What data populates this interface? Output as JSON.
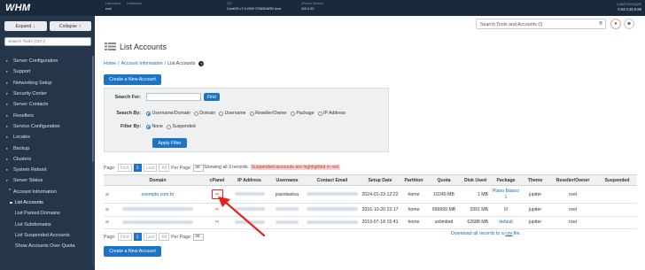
{
  "topbar": {
    "logo": "WHM",
    "username_label": "Username",
    "username": "root",
    "hostname_label": "Hostname",
    "hostname": "",
    "os_label": "OS",
    "os": "CentOS v7.9.2009 STANDARD kvm",
    "version_label": "cPanel Version",
    "version": "110.0.20",
    "load_label": "Load Averages",
    "load": "0.04 0.36 0.65"
  },
  "sidebar": {
    "expand_label": "Expand",
    "collapse_label": "Collapse",
    "search_placeholder": "Search Tools (Ctrl /)",
    "items": [
      {
        "label": "Server Configuration"
      },
      {
        "label": "Support"
      },
      {
        "label": "Networking Setup"
      },
      {
        "label": "Security Center"
      },
      {
        "label": "Server Contacts"
      },
      {
        "label": "Resellers"
      },
      {
        "label": "Service Configuration"
      },
      {
        "label": "Locales"
      },
      {
        "label": "Backup"
      },
      {
        "label": "Clusters"
      },
      {
        "label": "System Reboot"
      },
      {
        "label": "Server Status"
      },
      {
        "label": "Account Information"
      }
    ],
    "subitems": [
      {
        "label": "List Accounts"
      },
      {
        "label": "List Parked Domains"
      },
      {
        "label": "List Subdomains"
      },
      {
        "label": "List Suspended Accounts"
      },
      {
        "label": "Show Accounts Over Quota"
      }
    ]
  },
  "header": {
    "search_placeholder": "Search Tools and Accounts (/)"
  },
  "page": {
    "title": "List Accounts",
    "breadcrumb": [
      "Home",
      "Account Information",
      "List Accounts"
    ],
    "create_button": "Create a New Account"
  },
  "filter": {
    "search_for_label": "Search For:",
    "search_value": "",
    "find_button": "Find",
    "search_by_label": "Search By:",
    "search_by_options": [
      "Username/Domain",
      "Domain",
      "Username",
      "Reseller/Owner",
      "Package",
      "IP Address"
    ],
    "filter_by_label": "Filter By:",
    "filter_by_options": [
      "None",
      "Suspended"
    ],
    "apply_button": "Apply Filter"
  },
  "pager": {
    "page_label": "Page:",
    "first": "First",
    "current": "1",
    "last": "Last",
    "all": "All",
    "per_page_label": "Per Page:",
    "per_page": "30",
    "showing": "Showing all 3 records.",
    "suspended_note": "Suspended accounts are highlighted in red."
  },
  "table": {
    "columns": [
      "Domain",
      "cPanel",
      "IP Address",
      "Username",
      "Contact Email",
      "Setup Date",
      "Partition",
      "Quota",
      "Disk Used",
      "Package",
      "Theme",
      "Reseller/Owner",
      "Suspended"
    ],
    "rows": [
      {
        "domain": "exemplo.com.br",
        "username": "joaodasilva",
        "setup": "2024-01-23 12:22",
        "partition": "home",
        "quota": "10240 MB",
        "disk": "1 MB",
        "package": "Plano Básico 1",
        "theme": "jupiter",
        "owner": "root",
        "suspended": ""
      },
      {
        "domain": "",
        "username": "",
        "setup": "2016-10-20 22:17",
        "partition": "home",
        "quota": "999999 MB",
        "disk": "3391 MB",
        "package": "M",
        "theme": "jupiter",
        "owner": "root",
        "suspended": ""
      },
      {
        "domain": "",
        "username": "",
        "setup": "2019-07-18 15:41",
        "partition": "home",
        "quota": "unlimited",
        "disk": "62688 MB",
        "package": "default",
        "theme": "jupiter",
        "owner": "root",
        "suspended": ""
      }
    ]
  },
  "download": {
    "text": "Download all records to a ",
    "link": "csv",
    "suffix": " file."
  },
  "colors": {
    "topbar": "#1a2a3d",
    "sidebar": "#25364a",
    "primary_button": "#1e74c4",
    "cpanel_icon": "#ff6c2c",
    "annotation": "#e3231f"
  }
}
